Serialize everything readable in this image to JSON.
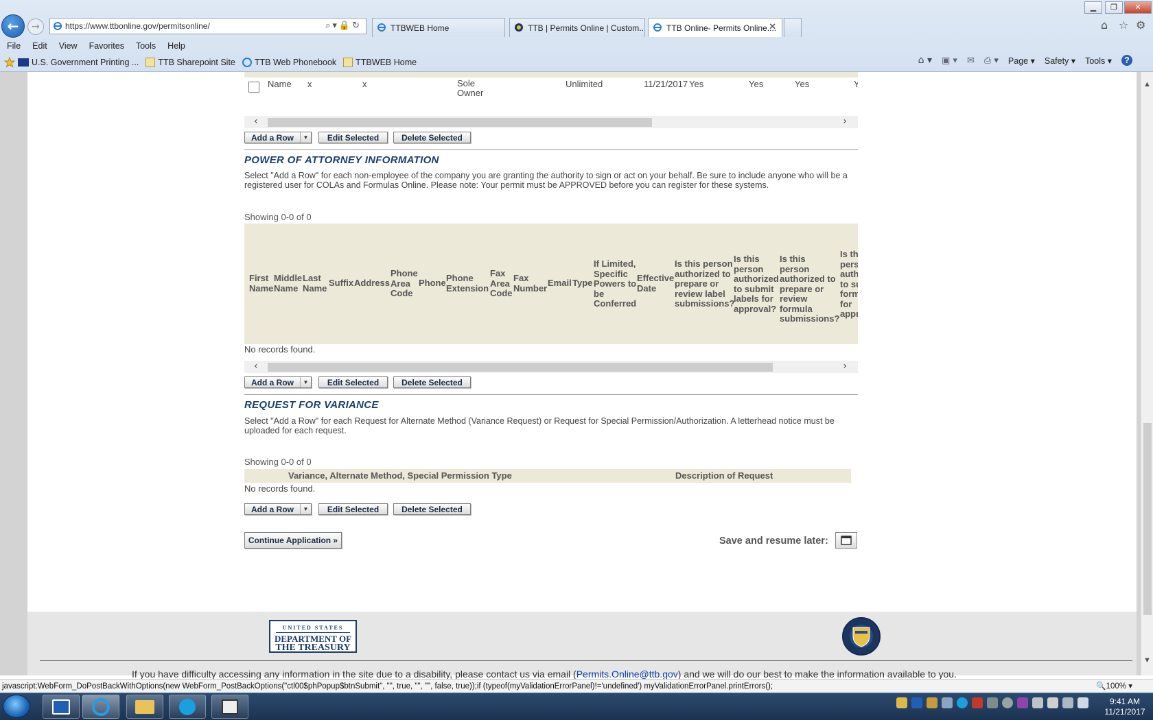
{
  "browser": {
    "url": "https://www.ttbonline.gov/permitsonline/",
    "tabs": [
      {
        "label": "TTBWEB Home"
      },
      {
        "label": "TTB | Permits Online | Custom..."
      },
      {
        "label": "TTB Online- Permits Online...."
      }
    ],
    "menu": [
      "File",
      "Edit",
      "View",
      "Favorites",
      "Tools",
      "Help"
    ],
    "favorites": [
      {
        "label": "U.S. Government Printing ..."
      },
      {
        "label": "TTB Sharepoint Site"
      },
      {
        "label": "TTB Web Phonebook"
      },
      {
        "label": "TTBWEB Home"
      }
    ],
    "commands": [
      "Page",
      "Safety",
      "Tools"
    ],
    "status_text": "javascript:WebForm_DoPostBackWithOptions(new WebForm_PostBackOptions(\"ctl00$phPopup$btnSubmit\", \"\", true, \"\", \"\", false, true));if (typeof(myValidationErrorPanel)!='undefined') myValidationErrorPanel.printErrors();",
    "zoom": "100%"
  },
  "grid1": {
    "row": {
      "c1": "Name",
      "c2": "x",
      "c3": "x",
      "c4": "Sole Owner",
      "c5": "Unlimited",
      "c6": "11/21/2017",
      "c7": "Yes",
      "c8": "Yes",
      "c9": "Yes",
      "c10": "Y"
    }
  },
  "buttons": {
    "add_row": "Add a Row",
    "edit_selected": "Edit Selected",
    "delete_selected": "Delete Selected",
    "continue": "Continue Application »",
    "save_later": "Save and resume later:"
  },
  "poa": {
    "title": "POWER OF ATTORNEY INFORMATION",
    "desc": "Select \"Add a Row\" for each non-employee of the company you are granting the authority to sign or act on your behalf. Be sure to include anyone who will be a registered user for COLAs and Formulas Online. Please note: Your permit must be APPROVED before you can register for these systems.",
    "showing": "Showing 0-0 of 0",
    "no_records": "No records found.",
    "headers": [
      "First Name",
      "Middle Name",
      "Last Name",
      "Suffix",
      "Address",
      "Phone Area Code",
      "Phone",
      "Phone Extension",
      "Fax Area Code",
      "Fax Number",
      "Email",
      "Type",
      "If Limited, Specific Powers to be Conferred",
      "Effective Date",
      "Is this person authorized to prepare or review label submissions?",
      "Is this person authorized to submit labels for approval?",
      "Is this person authorized to prepare or review formula submissions?",
      "Is this person authorized to submit formulas for approval?"
    ]
  },
  "variance": {
    "title": "REQUEST FOR VARIANCE",
    "desc": "Select \"Add a Row\" for each Request for Alternate Method (Variance Request) or Request for Special Permission/Authorization. A letterhead notice must be uploaded for each request.",
    "showing": "Showing 0-0 of 0",
    "no_records": "No records found.",
    "headers": [
      "Variance, Alternate Method, Special Permission Type",
      "Description of Request"
    ]
  },
  "footer": {
    "treasury_lines": [
      "UNITED STATES",
      "DEPARTMENT OF",
      "THE TREASURY"
    ],
    "disability_pre": "If you have difficulty accessing any information in the site due to a disability, please contact us via email (",
    "disability_link": "Permits.Online@ttb.gov",
    "disability_post": ") and we will do our best to make the information available to you."
  },
  "taskbar": {
    "time": "9:41 AM",
    "date": "11/21/2017"
  },
  "colors": {
    "section_title": "#1a3f6e",
    "grid_header": "#ece9d8"
  }
}
